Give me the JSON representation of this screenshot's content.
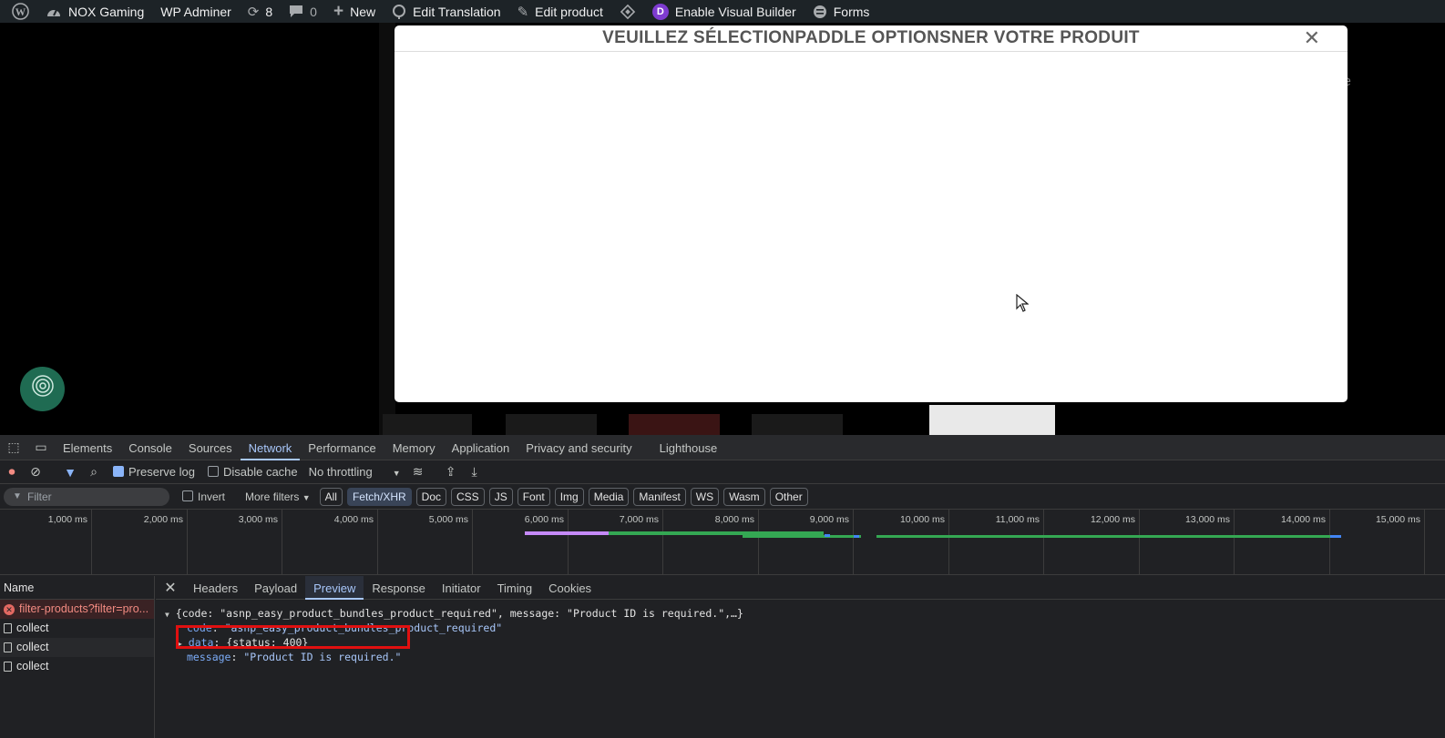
{
  "adminbar": {
    "site_name": "NOX Gaming",
    "wp_adminer": "WP Adminer",
    "updates_count": "8",
    "comments_count": "0",
    "new_label": "New",
    "edit_translation": "Edit Translation",
    "edit_product": "Edit product",
    "divi_letter": "D",
    "visual_builder": "Enable Visual Builder",
    "forms": "Forms"
  },
  "page": {
    "ghost_text": "e"
  },
  "modal": {
    "title": "VEUILLEZ SÉLECTIONPADDLE OPTIONSNER VOTRE PRODUIT",
    "close_glyph": "✕"
  },
  "devtools": {
    "tabs": [
      "Elements",
      "Console",
      "Sources",
      "Network",
      "Performance",
      "Memory",
      "Application",
      "Privacy and security",
      "Lighthouse"
    ],
    "active_tab": "Network",
    "toolbar": {
      "preserve_log": "Preserve log",
      "disable_cache": "Disable cache",
      "throttling": "No throttling"
    },
    "filter": {
      "placeholder": "Filter",
      "invert": "Invert",
      "more_filters": "More filters",
      "chips": [
        "All",
        "Fetch/XHR",
        "Doc",
        "CSS",
        "JS",
        "Font",
        "Img",
        "Media",
        "Manifest",
        "WS",
        "Wasm",
        "Other"
      ],
      "active_chip": "Fetch/XHR"
    },
    "timeline_ticks": [
      "1,000 ms",
      "2,000 ms",
      "3,000 ms",
      "4,000 ms",
      "5,000 ms",
      "6,000 ms",
      "7,000 ms",
      "8,000 ms",
      "9,000 ms",
      "10,000 ms",
      "11,000 ms",
      "12,000 ms",
      "13,000 ms",
      "14,000 ms",
      "15,000 ms"
    ],
    "requests_header": "Name",
    "requests": [
      {
        "name": "filter-products?filter=pro...",
        "status": "error"
      },
      {
        "name": "collect",
        "status": "ok"
      },
      {
        "name": "collect",
        "status": "ok"
      },
      {
        "name": "collect",
        "status": "ok"
      }
    ],
    "detail_tabs": [
      "Headers",
      "Payload",
      "Preview",
      "Response",
      "Initiator",
      "Timing",
      "Cookies"
    ],
    "active_detail_tab": "Preview",
    "preview": {
      "summary": "{code: \"asnp_easy_product_bundles_product_required\", message: \"Product ID is required.\",…}",
      "code_key": "code",
      "code_value": "\"asnp_easy_product_bundles_product_required\"",
      "data_key": "data",
      "data_value": "{status: 400}",
      "message_key": "message",
      "message_value": "\"Product ID is required.\""
    }
  }
}
